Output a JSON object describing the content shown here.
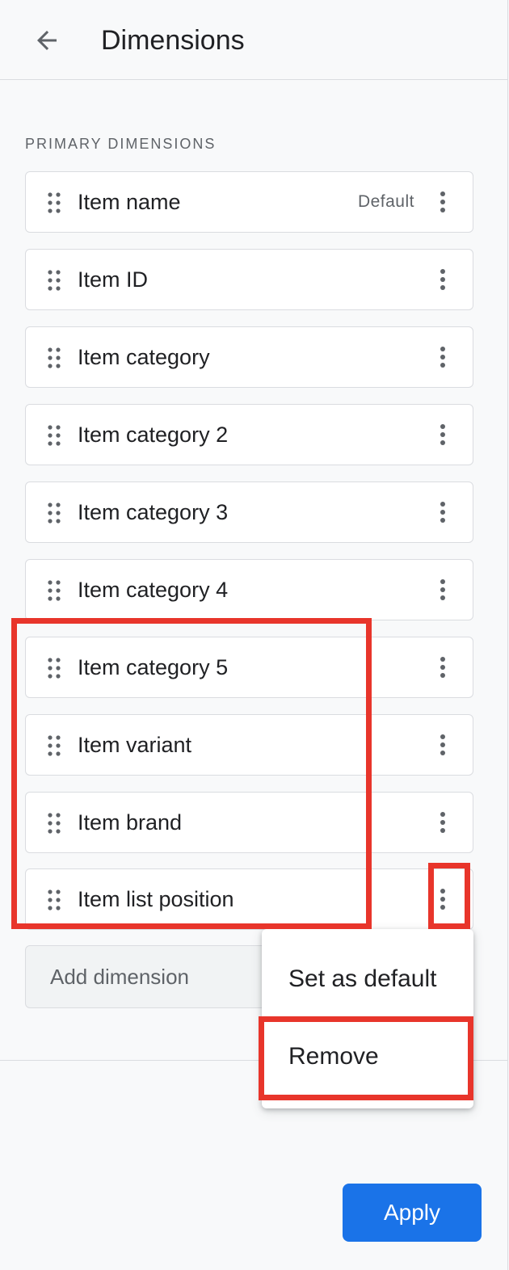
{
  "header": {
    "title": "Dimensions",
    "back_icon": "arrow-back-icon"
  },
  "section": {
    "label": "PRIMARY DIMENSIONS"
  },
  "dimensions": [
    {
      "label": "Item name",
      "badge": "Default"
    },
    {
      "label": "Item ID"
    },
    {
      "label": "Item category"
    },
    {
      "label": "Item category 2"
    },
    {
      "label": "Item category 3"
    },
    {
      "label": "Item category 4"
    },
    {
      "label": "Item category 5"
    },
    {
      "label": "Item variant"
    },
    {
      "label": "Item brand"
    },
    {
      "label": "Item list position"
    }
  ],
  "add_dimension": {
    "placeholder": "Add dimension",
    "value": ""
  },
  "menu": {
    "items": [
      "Set as default",
      "Remove"
    ]
  },
  "footer": {
    "apply_label": "Apply"
  },
  "colors": {
    "primary": "#1a73e8",
    "highlight": "#e8352b",
    "background": "#f8f9fa"
  },
  "icons": {
    "drag": "drag-handle-icon",
    "more": "more-vert-icon"
  }
}
